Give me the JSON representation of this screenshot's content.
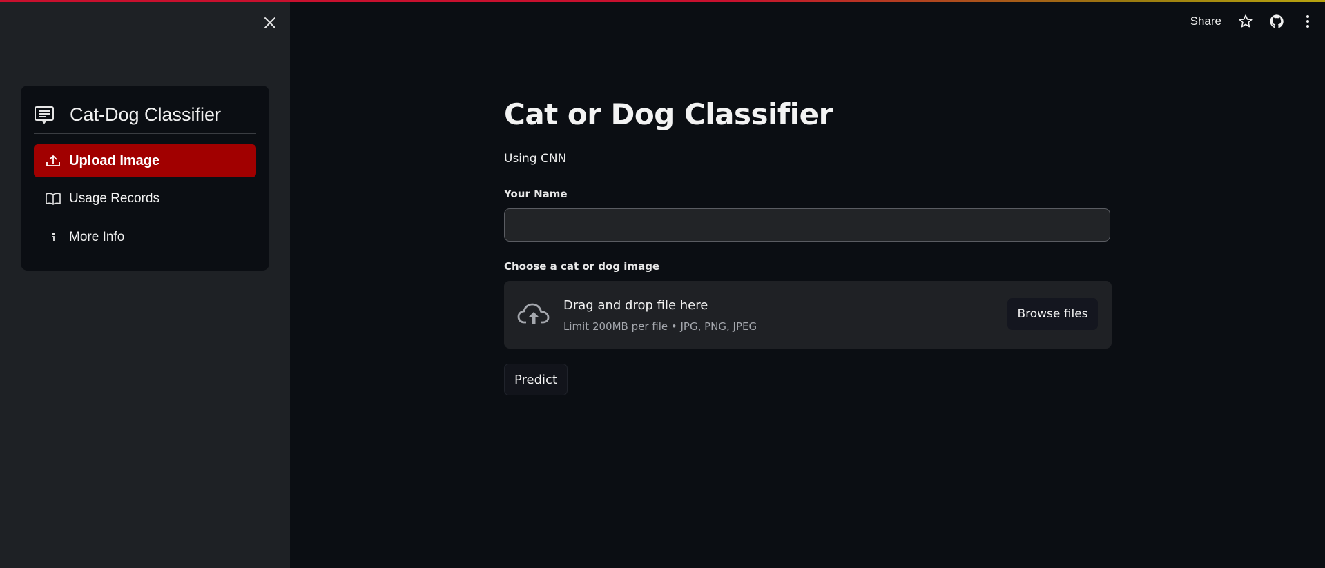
{
  "header": {
    "share_label": "Share",
    "icons": [
      "star-icon",
      "github-icon",
      "more-vertical-icon"
    ]
  },
  "sidebar": {
    "menu_title": "Cat-Dog Classifier",
    "menu_icon": "card-text-icon",
    "items": [
      {
        "label": "Upload Image",
        "icon": "upload-icon",
        "active": true
      },
      {
        "label": "Usage Records",
        "icon": "book-icon",
        "active": false
      },
      {
        "label": "More Info",
        "icon": "info-icon",
        "active": false
      }
    ]
  },
  "main": {
    "title": "Cat or Dog Classifier",
    "subtitle": "Using CNN",
    "name_field": {
      "label": "Your Name",
      "value": "",
      "placeholder": ""
    },
    "uploader": {
      "label": "Choose a cat or dog image",
      "drop_text": "Drag and drop file here",
      "limit_text": "Limit 200MB per file • JPG, PNG, JPEG",
      "browse_label": "Browse files"
    },
    "predict_label": "Predict"
  },
  "colors": {
    "accent_red": "#a10000",
    "background": "#0b0e13",
    "sidebar_bg": "#1e2125"
  }
}
